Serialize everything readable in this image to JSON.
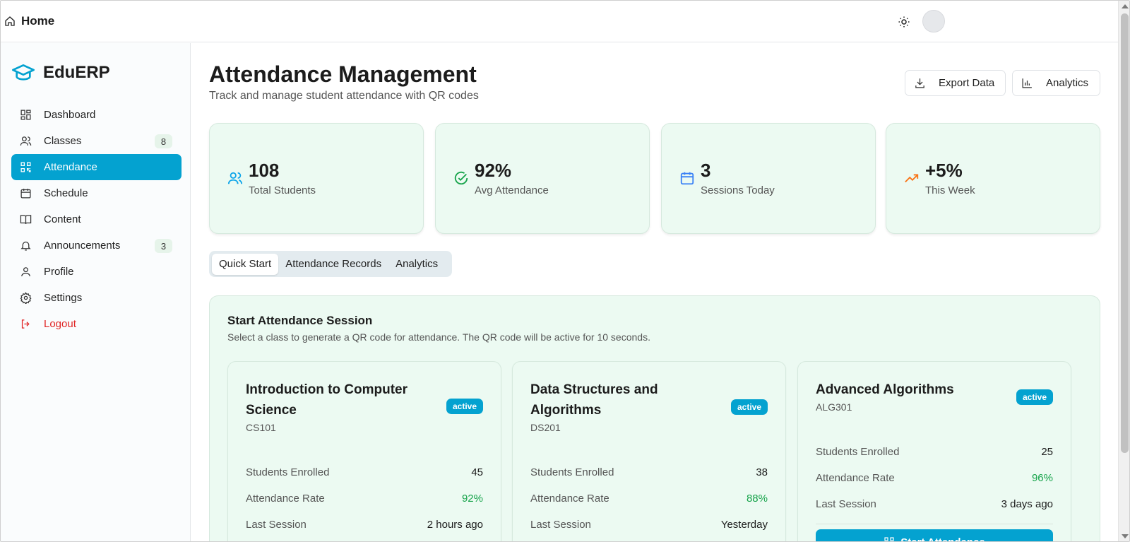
{
  "topbar": {
    "home_label": "Home"
  },
  "brand": {
    "name": "EduERP"
  },
  "sidebar": {
    "items": [
      {
        "label": "Dashboard",
        "icon": "dashboard-icon"
      },
      {
        "label": "Classes",
        "icon": "users-icon",
        "badge": "8"
      },
      {
        "label": "Attendance",
        "icon": "qr-code-icon"
      },
      {
        "label": "Schedule",
        "icon": "calendar-icon"
      },
      {
        "label": "Content",
        "icon": "book-icon"
      },
      {
        "label": "Announcements",
        "icon": "bell-icon",
        "badge": "3"
      },
      {
        "label": "Profile",
        "icon": "user-icon"
      },
      {
        "label": "Settings",
        "icon": "gear-icon"
      },
      {
        "label": "Logout",
        "icon": "logout-icon"
      }
    ]
  },
  "header": {
    "title": "Attendance Management",
    "subtitle": "Track and manage student attendance with QR codes",
    "export_label": "Export Data",
    "analytics_label": "Analytics"
  },
  "stats": [
    {
      "value": "108",
      "label": "Total Students",
      "icon": "users-icon",
      "color": "#0ea5e9"
    },
    {
      "value": "92%",
      "label": "Avg Attendance",
      "icon": "check-circle-icon",
      "color": "#16a34a"
    },
    {
      "value": "3",
      "label": "Sessions Today",
      "icon": "calendar-icon",
      "color": "#3b82f6"
    },
    {
      "value": "+5%",
      "label": "This Week",
      "icon": "trending-up-icon",
      "color": "#f97316"
    }
  ],
  "tabs": [
    "Quick Start",
    "Attendance Records",
    "Analytics"
  ],
  "session": {
    "title": "Start Attendance Session",
    "subtitle": "Select a class to generate a QR code for attendance. The QR code will be active for 10 seconds."
  },
  "classes": [
    {
      "name": "Introduction to Computer Science",
      "code": "CS101",
      "status": "active",
      "enrolled_label": "Students Enrolled",
      "enrolled": "45",
      "rate_label": "Attendance Rate",
      "rate": "92%",
      "last_label": "Last Session",
      "last": "2 hours ago"
    },
    {
      "name": "Data Structures and Algorithms",
      "code": "DS201",
      "status": "active",
      "enrolled_label": "Students Enrolled",
      "enrolled": "38",
      "rate_label": "Attendance Rate",
      "rate": "88%",
      "last_label": "Last Session",
      "last": "Yesterday"
    },
    {
      "name": "Advanced Algorithms",
      "code": "ALG301",
      "status": "active",
      "enrolled_label": "Students Enrolled",
      "enrolled": "25",
      "rate_label": "Attendance Rate",
      "rate": "96%",
      "last_label": "Last Session",
      "last": "3 days ago",
      "button_label": "Start Attendance"
    }
  ],
  "colors": {
    "accent": "#04a2d0",
    "card_bg": "#ecfaf2",
    "success": "#16a34a",
    "danger": "#e02424"
  }
}
